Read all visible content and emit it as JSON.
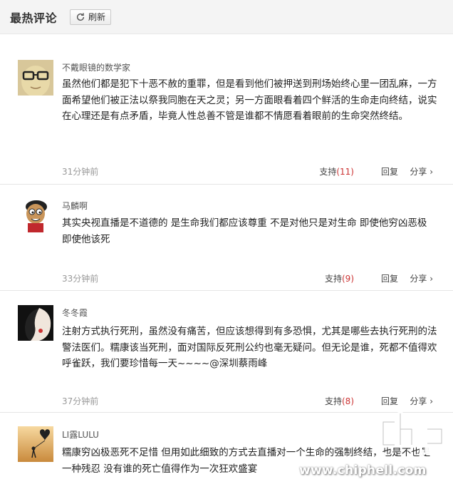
{
  "header": {
    "title": "最热评论",
    "refresh_label": "刷新"
  },
  "comments": [
    {
      "username": "不戴眼镜的数学家",
      "content": "虽然他们都是犯下十恶不赦的重罪，但是看到他们被押送到刑场始终心里一团乱麻，一方面希望他们被正法以祭我同胞在天之灵；另一方面眼看着四个鲜活的生命走向终结，说实在心理还是有点矛盾，毕竟人性总善不管是谁都不情愿看着眼前的生命突然终结。",
      "time": "31分钟前",
      "support_label": "支持",
      "support_count": "(11)",
      "reply_label": "回复",
      "share_label": "分享"
    },
    {
      "username": "马麟啊",
      "content": "其实央视直播是不道德的 是生命我们都应该尊重 不是对他只是对生命 即使他穷凶恶极 即使他该死",
      "time": "33分钟前",
      "support_label": "支持",
      "support_count": "(9)",
      "reply_label": "回复",
      "share_label": "分享"
    },
    {
      "username": "冬冬霞",
      "content": "注射方式执行死刑，虽然没有痛苦，但应该想得到有多恐惧，尤其是哪些去执行死刑的法警法医们。糯康该当死刑，面对国际反死刑公约也毫无疑问。但无论是谁，死都不值得欢呼雀跃，我们要珍惜每一天~~~~@深圳蔡雨峰",
      "time": "37分钟前",
      "support_label": "支持",
      "support_count": "(8)",
      "reply_label": "回复",
      "share_label": "分享"
    },
    {
      "username": "LI露LULU",
      "content": "糯康穷凶极恶死不足惜 但用如此细致的方式去直播对一个生命的强制终结，也是不也是一种残忍 没有谁的死亡值得作为一次狂欢盛宴"
    }
  ],
  "watermark": {
    "url": "www.chiphell.com",
    "logo_text": "chip hell"
  },
  "colors": {
    "count": "#cc3333",
    "header_bg": "#f4f4f4",
    "meta": "#999999"
  }
}
